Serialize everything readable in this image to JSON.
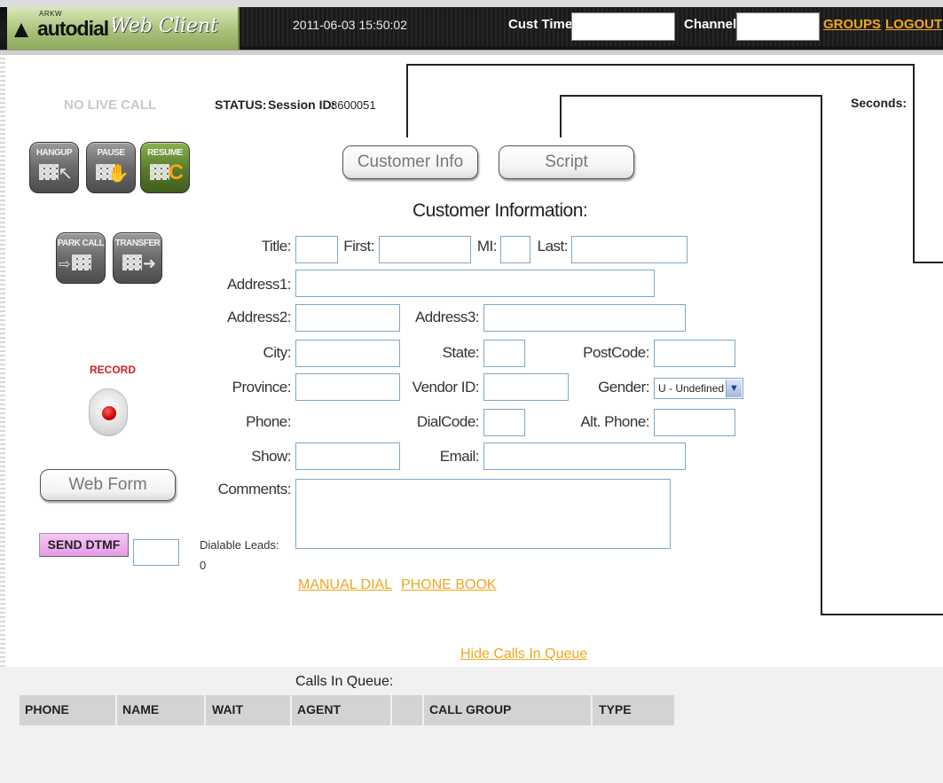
{
  "header": {
    "logo_small": "ARKW",
    "logo_brand": "autodial",
    "logo_product": "Web Client",
    "datetime": "2011-06-03 15:50:02",
    "cust_time_label": "Cust Time:",
    "channel_label": "Channel:",
    "groups_link": "GROUPS",
    "logout_link": "LOGOUT"
  },
  "status": {
    "no_live_call": "NO LIVE CALL",
    "status_label": "STATUS:",
    "session_label": "Session ID:",
    "session_id": "8600051",
    "seconds_label": "Seconds:"
  },
  "controls": {
    "hangup": "HANGUP",
    "pause": "PAUSE",
    "resume": "RESUME",
    "park_call": "PARK CALL",
    "transfer": "TRANSFER",
    "record": "RECORD",
    "web_form": "Web Form",
    "send_dtmf": "SEND DTMF"
  },
  "tabs": {
    "customer_info": "Customer Info",
    "script": "Script"
  },
  "form": {
    "title": "Customer Information:",
    "labels": {
      "title": "Title:",
      "first": "First:",
      "mi": "MI:",
      "last": "Last:",
      "address1": "Address1:",
      "address2": "Address2:",
      "address3": "Address3:",
      "city": "City:",
      "state": "State:",
      "postcode": "PostCode:",
      "province": "Province:",
      "vendor_id": "Vendor ID:",
      "gender": "Gender:",
      "phone": "Phone:",
      "dialcode": "DialCode:",
      "alt_phone": "Alt. Phone:",
      "show": "Show:",
      "email": "Email:",
      "comments": "Comments:"
    },
    "gender_value": "U - Undefined",
    "values": {
      "title": "",
      "first": "",
      "mi": "",
      "last": "",
      "address1": "",
      "address2": "",
      "address3": "",
      "city": "",
      "state": "",
      "postcode": "",
      "province": "",
      "vendor_id": "",
      "dialcode": "",
      "alt_phone": "",
      "show": "",
      "email": "",
      "comments": ""
    }
  },
  "dialable": {
    "label": "Dialable Leads:",
    "count": "0"
  },
  "links": {
    "manual_dial": "MANUAL DIAL",
    "phone_book": "PHONE BOOK",
    "hide_queue": "Hide Calls In Queue"
  },
  "queue": {
    "title": "Calls In Queue:",
    "columns": [
      "PHONE",
      "NAME",
      "WAIT",
      "AGENT",
      "",
      "CALL GROUP",
      "TYPE"
    ]
  },
  "colors": {
    "link": "#f0a520",
    "header_bg": "#1a1a1a",
    "logo_green": "#a9c27a",
    "dtmf_pink": "#e79ae7",
    "record_red": "#cc0000",
    "input_border": "#7fa6c9"
  }
}
